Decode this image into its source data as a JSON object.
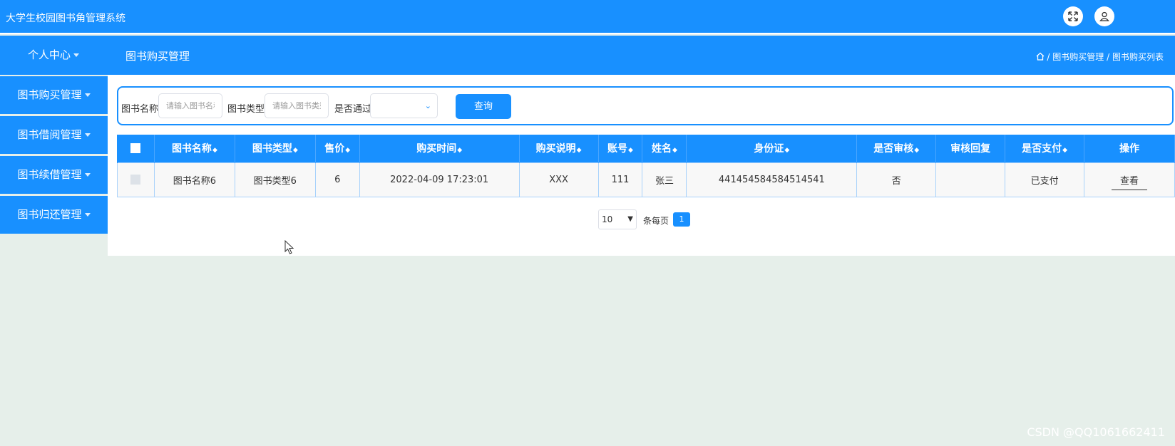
{
  "app": {
    "title": "大学生校园图书角管理系统"
  },
  "header": {
    "personal_center": "个人中心",
    "page_heading": "图书购买管理",
    "breadcrumb": [
      "图书购买管理",
      "图书购买列表"
    ],
    "separator": "/"
  },
  "sidebar": {
    "items": [
      {
        "label": "图书购买管理"
      },
      {
        "label": "图书借阅管理"
      },
      {
        "label": "图书续借管理"
      },
      {
        "label": "图书归还管理"
      }
    ]
  },
  "search": {
    "book_name_label": "图书名称",
    "book_name_placeholder": "请输入图书名称",
    "book_type_label": "图书类型",
    "book_type_placeholder": "请输入图书类型",
    "approved_label": "是否通过",
    "approved_value": "",
    "query_button": "查询"
  },
  "table": {
    "columns": [
      "图书名称",
      "图书类型",
      "售价",
      "购买时间",
      "购买说明",
      "账号",
      "姓名",
      "身份证",
      "是否审核",
      "审核回复",
      "是否支付",
      "操作"
    ],
    "rows": [
      {
        "book_name": "图书名称6",
        "book_type": "图书类型6",
        "price": "6",
        "purchase_time": "2022-04-09 17:23:01",
        "description": "XXX",
        "account": "111",
        "name": "张三",
        "id_card": "441454584584514541",
        "reviewed": "否",
        "review_reply": "",
        "paid": "已支付",
        "action": "查看"
      }
    ]
  },
  "pagination": {
    "page_size": "10",
    "page_size_label": "条每页",
    "current_page": "1"
  },
  "watermark": "CSDN @QQ1061662411",
  "colors": {
    "primary": "#1890ff",
    "background": "#e6efea"
  },
  "icons": [
    "fullscreen-icon",
    "user-icon",
    "home-icon",
    "sort-icon",
    "mouse-cursor"
  ]
}
